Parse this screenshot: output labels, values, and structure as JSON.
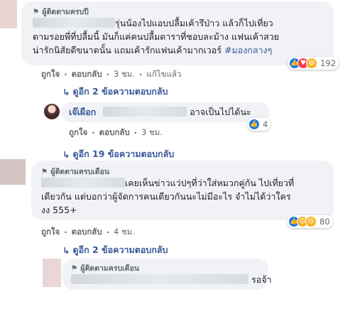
{
  "comment1": {
    "badge": "ผู้ติดตามครบปี",
    "line1_text": "รุ่นน้องไปแอบปลื้มเค้ารึป่าว แล้วก็ไปเที่ยว",
    "line2_text": "ตามรอยพี่ที่ปลื้มนี้ มันก็แค่คนปลื้มดาราที่ชอบละม้าง แฟนเค้าสวย",
    "line3_text": "น่ารักนิสัยดีขนาดนั้น แถมเค้ารักแฟนเค้ามากเวอร์ ",
    "hashtag": "#มองกลางๆ",
    "reaction_count": "192",
    "actions": {
      "like": "ถูกใจ",
      "reply": "ตอบกลับ",
      "time": "3 ชม.",
      "edited": "แก้ไขแล้ว"
    },
    "replies_link": "ดูอีก 2 ข้อความตอบกลับ"
  },
  "reply1": {
    "name": "เจ๊เผือก",
    "text": "อาจเป็นไปได้นะ",
    "reaction_count": "4",
    "actions": {
      "like": "ถูกใจ",
      "reply": "ตอบกลับ",
      "time": "3 ชม."
    }
  },
  "more_replies": "ดูอีก 19 ข้อความตอบกลับ",
  "comment2": {
    "badge": "ผู้ติดตามครบเดือน",
    "line1_text": "เคยเห็นข่าวแว่ปๆที่ว่าใส่หมวกคู่กัน ไปเที่ยวที่",
    "line2_text": "เดียวกัน แต่บอกว่าผู้จัดการคนเดียวกันนะไม่มีอะไร จำไม่ได้ว่าใคร",
    "line3_text": "งง 555+",
    "reaction_count": "80",
    "actions": {
      "like": "ถูกใจ",
      "reply": "ตอบกลับ",
      "time": "4 ชม."
    },
    "replies_link": "ดูอีก 2 ข้อความตอบกลับ"
  },
  "reply2": {
    "badge": "ผู้ติดตามครบเดือน",
    "text": "รอจ้า"
  }
}
